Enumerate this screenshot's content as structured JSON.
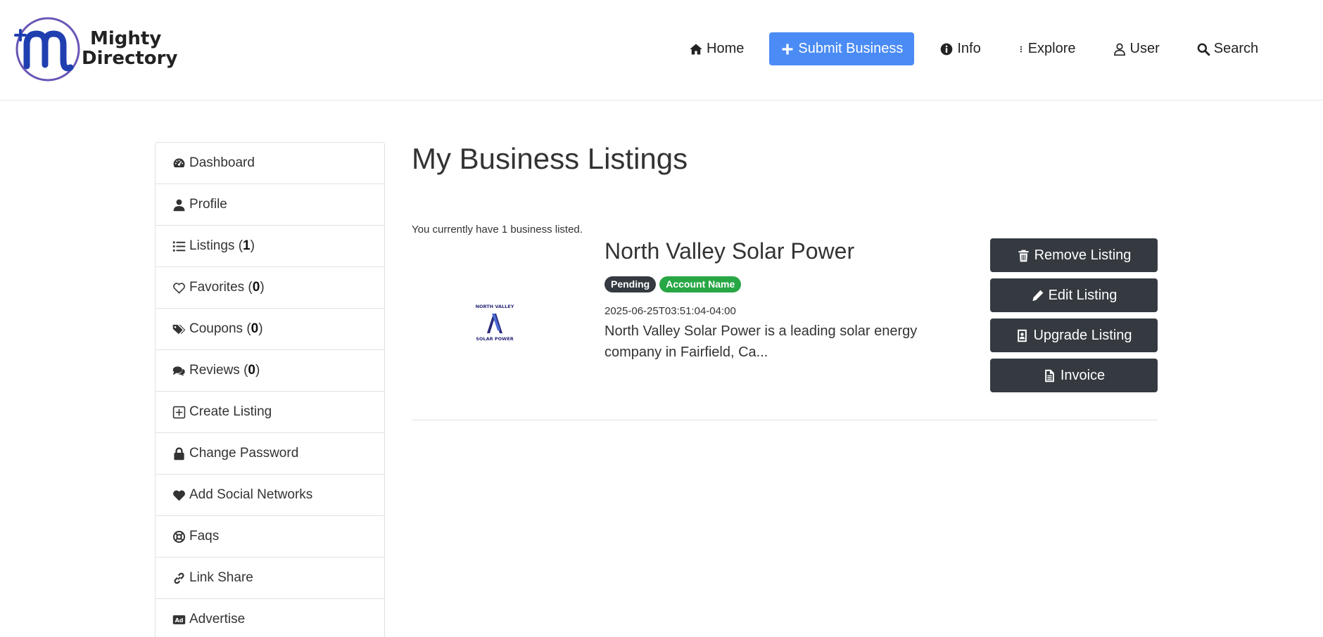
{
  "brand": {
    "line1": "Mighty",
    "line2": "Directory",
    "colors": {
      "ring": "#6a55b5",
      "mark": "#1f3fb0"
    }
  },
  "nav": {
    "home": {
      "label": "Home",
      "icon": "home-icon"
    },
    "submit": {
      "label": "Submit Business",
      "icon": "plus-icon",
      "color": "#4a8bf5"
    },
    "info": {
      "label": "Info",
      "icon": "info-circle-icon"
    },
    "explore": {
      "label": "Explore",
      "icon": "ellipsis-vertical-icon"
    },
    "user": {
      "label": "User",
      "icon": "user-icon"
    },
    "search": {
      "label": "Search",
      "icon": "search-icon"
    }
  },
  "sidebar": {
    "items": [
      {
        "label": "Dashboard",
        "icon": "tachometer-icon"
      },
      {
        "label": "Profile",
        "icon": "user-icon"
      },
      {
        "label": "Listings (",
        "count": "1",
        "suffix": ")",
        "icon": "list-icon"
      },
      {
        "label": "Favorites (",
        "count": "0",
        "suffix": ")",
        "icon": "heart-outline-icon"
      },
      {
        "label": "Coupons (",
        "count": "0",
        "suffix": ")",
        "icon": "tags-icon"
      },
      {
        "label": "Reviews (",
        "count": "0",
        "suffix": ")",
        "icon": "comments-icon"
      },
      {
        "label": "Create Listing",
        "icon": "plus-square-icon"
      },
      {
        "label": "Change Password",
        "icon": "lock-icon"
      },
      {
        "label": "Add Social Networks",
        "icon": "heart-icon"
      },
      {
        "label": "Faqs",
        "icon": "life-ring-icon"
      },
      {
        "label": "Link Share",
        "icon": "link-icon"
      },
      {
        "label": "Advertise",
        "icon": "ad-icon"
      }
    ]
  },
  "main": {
    "title": "My Business Listings",
    "count_text": "You currently have 1 business listed.",
    "listing": {
      "logo_line1": "NORTH VALLEY",
      "logo_line2": "SOLAR POWER",
      "title": "North Valley Solar Power",
      "badges": {
        "pending": "Pending",
        "account": "Account Name"
      },
      "date": "2025-06-25T03:51:04-04:00",
      "description": "North Valley Solar Power is a leading solar energy company in Fairfield, Ca..."
    },
    "actions": {
      "remove": "Remove Listing",
      "edit": "Edit Listing",
      "upgrade": "Upgrade Listing",
      "invoice": "Invoice"
    }
  }
}
